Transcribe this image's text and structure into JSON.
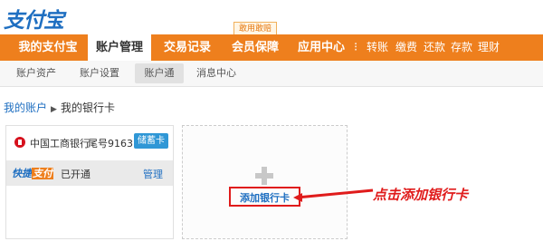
{
  "logo": "支付宝",
  "promo_badge": "敢用敢赔",
  "nav": {
    "items": [
      "我的支付宝",
      "账户管理",
      "交易记录",
      "会员保障",
      "应用中心"
    ],
    "dots": "⁝",
    "quick_links": [
      "转账",
      "缴费",
      "还款",
      "存款",
      "理财"
    ]
  },
  "subnav": {
    "items": [
      "账户资产",
      "账户设置",
      "账户通",
      "消息中心"
    ]
  },
  "breadcrumb": {
    "root": "我的账户",
    "arrow": "▶",
    "current": "我的银行卡"
  },
  "card": {
    "bank_name": "中国工商银行",
    "tail_number": "尾号9163",
    "card_type": "储蓄卡",
    "quickpay_a": "快捷",
    "quickpay_b": "支付",
    "status": "已开通",
    "manage": "管理"
  },
  "add_card": {
    "label": "添加银行卡"
  },
  "annotation": {
    "text": "点击添加银行卡",
    "color": "#e01b1b"
  },
  "colors": {
    "brand_orange": "#ee7f1d",
    "link_blue": "#1f6fc1",
    "badge_blue": "#2f97d6"
  }
}
